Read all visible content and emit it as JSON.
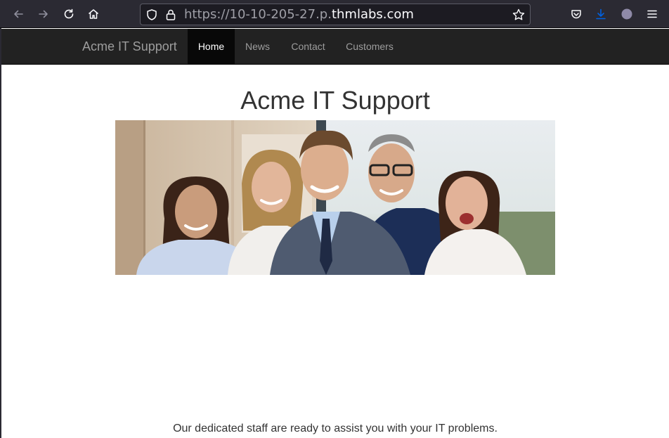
{
  "browser": {
    "url_scheme_host_prefix": "https://10-10-205-27.p.",
    "url_domain": "thmlabs.com",
    "icons": [
      "back-icon",
      "forward-icon",
      "reload-icon",
      "home-icon",
      "shield-icon",
      "lock-icon",
      "bookmark-star-icon",
      "pocket-icon",
      "download-icon",
      "account-icon",
      "menu-icon"
    ]
  },
  "navbar": {
    "brand": "Acme IT Support",
    "items": [
      {
        "label": "Home",
        "active": true
      },
      {
        "label": "News",
        "active": false
      },
      {
        "label": "Contact",
        "active": false
      },
      {
        "label": "Customers",
        "active": false
      }
    ]
  },
  "main": {
    "heading": "Acme IT Support",
    "hero_image": "team-photo",
    "tagline": "Our dedicated staff are ready to assist you with your IT problems."
  },
  "colors": {
    "browser_chrome": "#2b2a33",
    "navbar_bg": "#222222",
    "nav_active_bg": "#080808",
    "download_accent": "#0060df"
  }
}
